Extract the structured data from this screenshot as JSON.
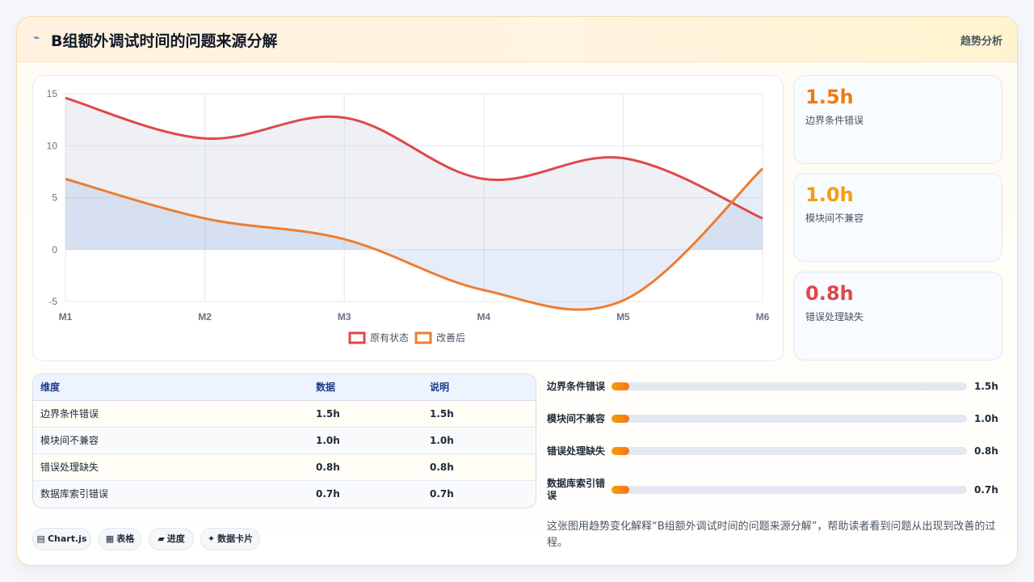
{
  "header": {
    "icon": "bolt-icon",
    "title": "B组额外调试时间的问题来源分解",
    "subtitle": "趋势分析"
  },
  "chart_data": {
    "type": "line",
    "x": [
      "M1",
      "M2",
      "M3",
      "M4",
      "M5",
      "M6"
    ],
    "ylim": [
      -5,
      15
    ],
    "yticks": [
      -5,
      0,
      5,
      10,
      15
    ],
    "series": [
      {
        "name": "原有状态",
        "values": [
          14.6,
          10.7,
          12.7,
          6.8,
          8.8,
          3.0
        ],
        "color": "#e0474c"
      },
      {
        "name": "改善后",
        "values": [
          6.8,
          3.0,
          1.0,
          -3.9,
          -4.9,
          7.8
        ],
        "color": "#ed7d31"
      }
    ],
    "legend": "bottom",
    "grid": true,
    "smooth": true
  },
  "stats": [
    {
      "value": "1.5h",
      "label": "边界条件错误",
      "color": "#f07a14"
    },
    {
      "value": "1.0h",
      "label": "模块间不兼容",
      "color": "#f59e0b"
    },
    {
      "value": "0.8h",
      "label": "错误处理缺失",
      "color": "#e0474c"
    }
  ],
  "table": {
    "headers": [
      "维度",
      "数据",
      "说明"
    ],
    "rows": [
      [
        "边界条件错误",
        "1.5h",
        "1.5h"
      ],
      [
        "模块间不兼容",
        "1.0h",
        "1.0h"
      ],
      [
        "错误处理缺失",
        "0.8h",
        "0.8h"
      ],
      [
        "数据库索引错误",
        "0.7h",
        "0.7h"
      ]
    ]
  },
  "bars": [
    {
      "label": "边界条件错误",
      "value": "1.5h",
      "progress": 0.05
    },
    {
      "label": "模块间不兼容",
      "value": "1.0h",
      "progress": 0.05
    },
    {
      "label": "错误处理缺失",
      "value": "0.8h",
      "progress": 0.05
    },
    {
      "label": "数据库索引错误",
      "value": "0.7h",
      "progress": 0.05
    }
  ],
  "chips": [
    {
      "icon": "▤",
      "label": "Chart.js"
    },
    {
      "icon": "▦",
      "label": "表格"
    },
    {
      "icon": "▰",
      "label": "进度"
    },
    {
      "icon": "✦",
      "label": "数据卡片"
    }
  ],
  "note": "这张图用趋势变化解释“B组额外调试时间的问题来源分解”，帮助读者看到问题从出现到改善的过程。"
}
